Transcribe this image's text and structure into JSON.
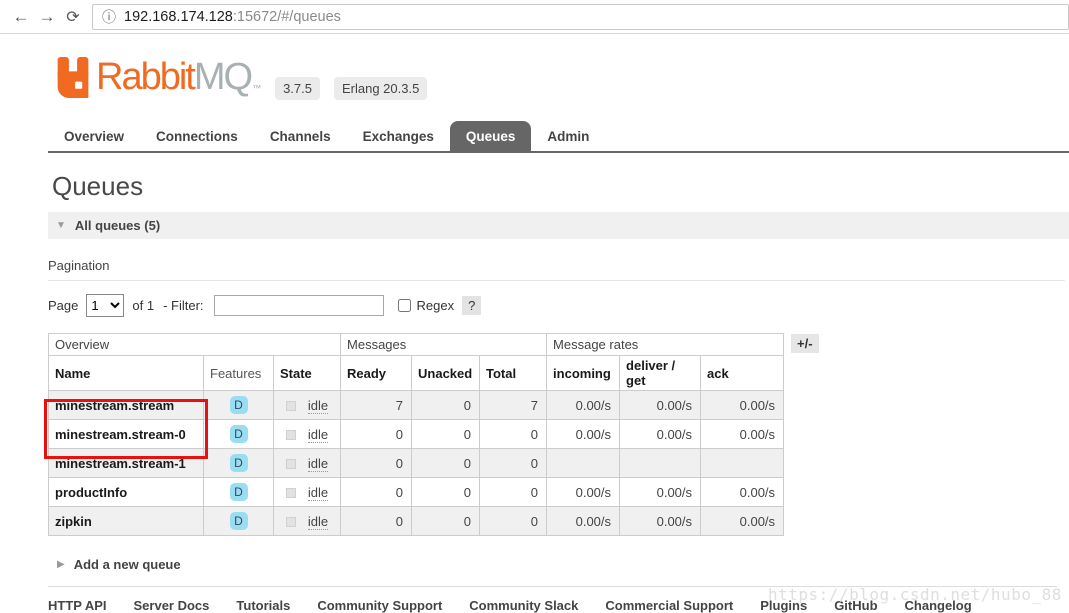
{
  "browser": {
    "back_glyph": "←",
    "forward_glyph": "→",
    "reload_glyph": "⟳",
    "info_glyph": "ⓘ",
    "url_host": "192.168.174.128",
    "url_path": ":15672/#/queues"
  },
  "header": {
    "brand_primary": "Rabbit",
    "brand_secondary": "MQ",
    "trademark": "™",
    "brand_color": "#f06a21",
    "badges": [
      "3.7.5",
      "Erlang 20.3.5"
    ]
  },
  "nav": {
    "tabs": [
      {
        "label": "Overview",
        "active": false
      },
      {
        "label": "Connections",
        "active": false
      },
      {
        "label": "Channels",
        "active": false
      },
      {
        "label": "Exchanges",
        "active": false
      },
      {
        "label": "Queues",
        "active": true
      },
      {
        "label": "Admin",
        "active": false
      }
    ]
  },
  "page": {
    "title": "Queues"
  },
  "sections": {
    "all_queues": {
      "label": "All queues (5)",
      "collapse_glyph": "▼"
    },
    "add_queue": {
      "label": "Add a new queue",
      "expand_glyph": "▶"
    }
  },
  "pagination": {
    "heading": "Pagination",
    "page_label": "Page",
    "page_value": "1",
    "of_label": "of 1",
    "filter_label": "- Filter:",
    "filter_value": "",
    "regex_label": "Regex",
    "help_label": "?"
  },
  "table": {
    "groups": [
      "Overview",
      "Messages",
      "Message rates"
    ],
    "columns": [
      "Name",
      "Features",
      "State",
      "Ready",
      "Unacked",
      "Total",
      "incoming",
      "deliver / get",
      "ack"
    ],
    "plus_minus": "+/-",
    "feature_badge_color": "#99ddf2",
    "rows": [
      {
        "name": "minestream.stream",
        "features": "D",
        "state": "idle",
        "ready": "7",
        "unacked": "0",
        "total": "7",
        "incoming": "0.00/s",
        "deliver_get": "0.00/s",
        "ack": "0.00/s"
      },
      {
        "name": "minestream.stream-0",
        "features": "D",
        "state": "idle",
        "ready": "0",
        "unacked": "0",
        "total": "0",
        "incoming": "0.00/s",
        "deliver_get": "0.00/s",
        "ack": "0.00/s"
      },
      {
        "name": "minestream.stream-1",
        "features": "D",
        "state": "idle",
        "ready": "0",
        "unacked": "0",
        "total": "0",
        "incoming": "",
        "deliver_get": "",
        "ack": ""
      },
      {
        "name": "productInfo",
        "features": "D",
        "state": "idle",
        "ready": "0",
        "unacked": "0",
        "total": "0",
        "incoming": "0.00/s",
        "deliver_get": "0.00/s",
        "ack": "0.00/s"
      },
      {
        "name": "zipkin",
        "features": "D",
        "state": "idle",
        "ready": "0",
        "unacked": "0",
        "total": "0",
        "incoming": "0.00/s",
        "deliver_get": "0.00/s",
        "ack": "0.00/s"
      }
    ]
  },
  "annotation": {
    "highlight_color": "#e91010"
  },
  "footer": {
    "links": [
      "HTTP API",
      "Server Docs",
      "Tutorials",
      "Community Support",
      "Community Slack",
      "Commercial Support",
      "Plugins",
      "GitHub",
      "Changelog"
    ]
  },
  "watermark": "https://blog.csdn.net/hubo_88"
}
